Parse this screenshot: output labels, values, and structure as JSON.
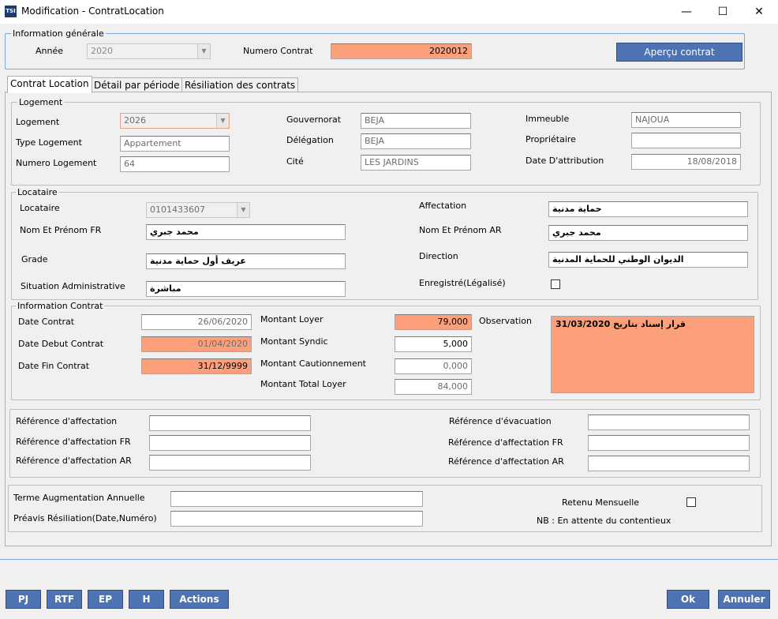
{
  "window": {
    "title": "Modification - ContratLocation",
    "icon_text": "TSI",
    "minimize": "—",
    "maximize": "☐",
    "close": "✕"
  },
  "info_generale": {
    "title": "Information générale",
    "annee_label": "Année",
    "annee_value": "2020",
    "numero_contrat_label": "Numero Contrat",
    "numero_contrat_value": "2020012",
    "apercu_button": "Aperçu contrat"
  },
  "tabs": [
    {
      "label": "Contrat Location"
    },
    {
      "label": "Détail par période"
    },
    {
      "label": "Résiliation des contrats"
    }
  ],
  "logement": {
    "title": "Logement",
    "logement_label": "Logement",
    "logement_value": "2026",
    "type_label": "Type Logement",
    "type_value": "Appartement",
    "numero_label": "Numero Logement",
    "numero_value": "64",
    "gouvernorat_label": "Gouvernorat",
    "gouvernorat_value": "BEJA",
    "delegation_label": "Délégation",
    "delegation_value": "BEJA",
    "cite_label": "Cité",
    "cite_value": "LES JARDINS",
    "immeuble_label": "Immeuble",
    "immeuble_value": "NAJOUA",
    "proprietaire_label": "Propriétaire",
    "proprietaire_value": "",
    "date_attribution_label": "Date D'attribution",
    "date_attribution_value": "18/08/2018"
  },
  "locataire": {
    "title": "Locataire",
    "locataire_label": "Locataire",
    "locataire_value": "0101433607",
    "nom_fr_label": "Nom Et Prénom FR",
    "nom_fr_value": "محمد جبري",
    "grade_label": "Grade",
    "grade_value": "عريف أول حماية مدنية",
    "situation_label": "Situation Administrative",
    "situation_value": "مباشرة",
    "affectation_label": "Affectation",
    "affectation_value": "حماية مدنية",
    "nom_ar_label": "Nom Et Prénom AR",
    "nom_ar_value": "محمد جبري",
    "direction_label": "Direction",
    "direction_value": "الديوان الوطني للحماية المدنية",
    "enregistre_label": "Enregistré(Légalisé)"
  },
  "info_contrat": {
    "title": "Information Contrat",
    "date_contrat_label": "Date Contrat",
    "date_contrat_value": "26/06/2020",
    "date_debut_label": "Date Debut Contrat",
    "date_debut_value": "01/04/2020",
    "date_fin_label": "Date Fin Contrat",
    "date_fin_value": "31/12/9999",
    "montant_loyer_label": "Montant Loyer",
    "montant_loyer_value": "79,000",
    "montant_syndic_label": "Montant Syndic",
    "montant_syndic_value": "5,000",
    "montant_caution_label": "Montant Cautionnement",
    "montant_caution_value": "0,000",
    "montant_total_label": "Montant Total Loyer",
    "montant_total_value": "84,000",
    "observation_label": "Observation",
    "observation_value": "قرار إسناد بتاريخ 31/03/2020"
  },
  "references": {
    "ref_affectation_label": "Référence d'affectation",
    "ref_affectation_fr_label": "Référence d'affectation FR",
    "ref_affectation_ar_label": "Référence d'affectation AR",
    "ref_evacuation_label": "Référence d'évacuation",
    "ref_affectation_fr2_label": "Référence d'affectation FR",
    "ref_affectation_ar2_label": "Référence d'affectation AR"
  },
  "bottom_group": {
    "terme_label": "Terme Augmentation Annuelle",
    "preavis_label": "Préavis Résiliation(Date,Numéro)",
    "retenu_label": "Retenu Mensuelle",
    "nb_text": "NB : En attente du contentieux"
  },
  "footer": {
    "pj": "PJ",
    "rtf": "RTF",
    "ep": "EP",
    "h": "H",
    "actions": "Actions",
    "ok": "Ok",
    "annuler": "Annuler"
  },
  "colors": {
    "accent_button": "#4e73b3",
    "highlight_field": "#fca07c"
  }
}
